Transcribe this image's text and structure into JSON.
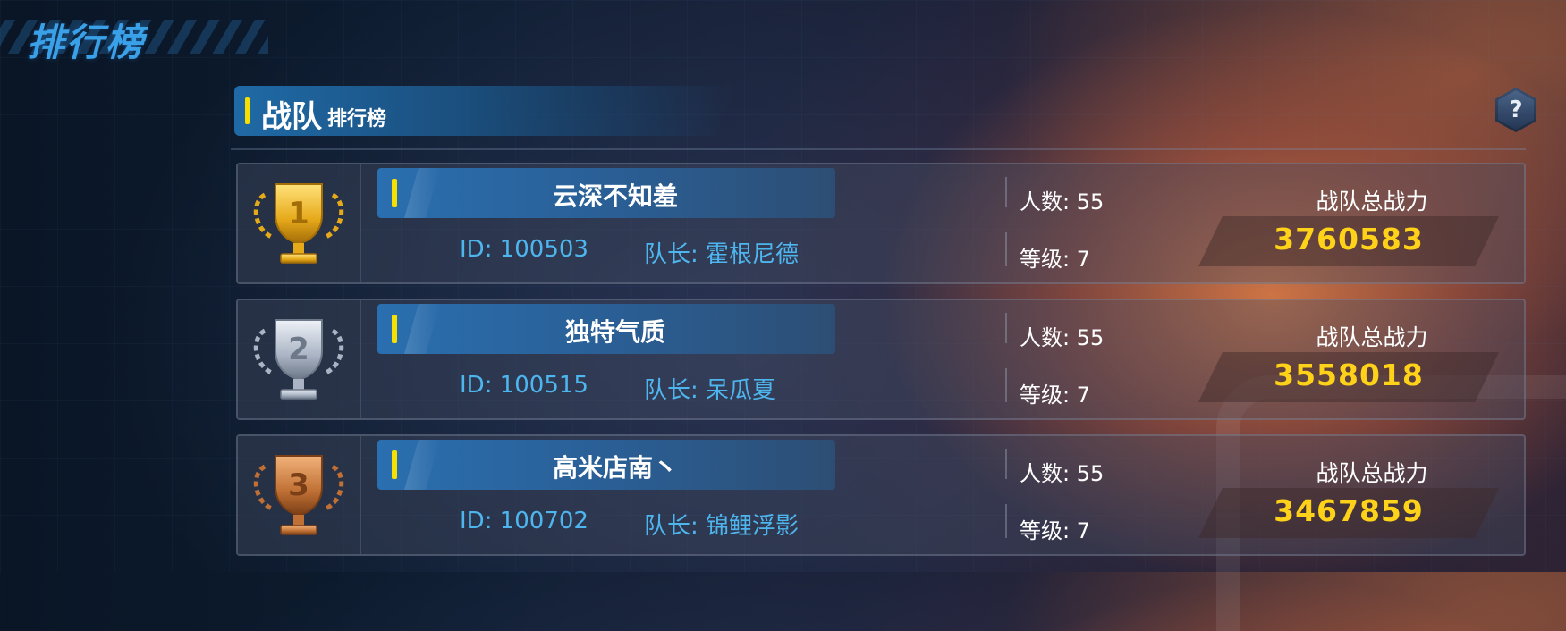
{
  "page": {
    "title": "排行榜"
  },
  "section": {
    "title_main": "战队",
    "title_sub": "排行榜",
    "help_icon": "?"
  },
  "colors": {
    "accent_yellow": "#f7e000",
    "id_blue": "#4eb6ee",
    "power_gold": "#ffd21a",
    "gold_trophy": "#f2c531",
    "silver_trophy": "#c9d0dc",
    "bronze_trophy": "#c77a3a"
  },
  "rows": [
    {
      "rank": "1",
      "trophy": "gold-trophy-icon",
      "name": "云深不知羞",
      "id_text": "ID: 100503",
      "leader_text": "队长: 霍根尼德",
      "members_text": "人数: 55",
      "level_text": "等级: 7",
      "power_label": "战队总战力",
      "power_value": "3760583"
    },
    {
      "rank": "2",
      "trophy": "silver-trophy-icon",
      "name": "独特气质",
      "id_text": "ID: 100515",
      "leader_text": "队长: 呆瓜夏",
      "members_text": "人数: 55",
      "level_text": "等级: 7",
      "power_label": "战队总战力",
      "power_value": "3558018"
    },
    {
      "rank": "3",
      "trophy": "bronze-trophy-icon",
      "name": "高米店南丶",
      "id_text": "ID: 100702",
      "leader_text": "队长: 锦鲤浮影",
      "members_text": "人数: 55",
      "level_text": "等级: 7",
      "power_label": "战队总战力",
      "power_value": "3467859"
    }
  ]
}
